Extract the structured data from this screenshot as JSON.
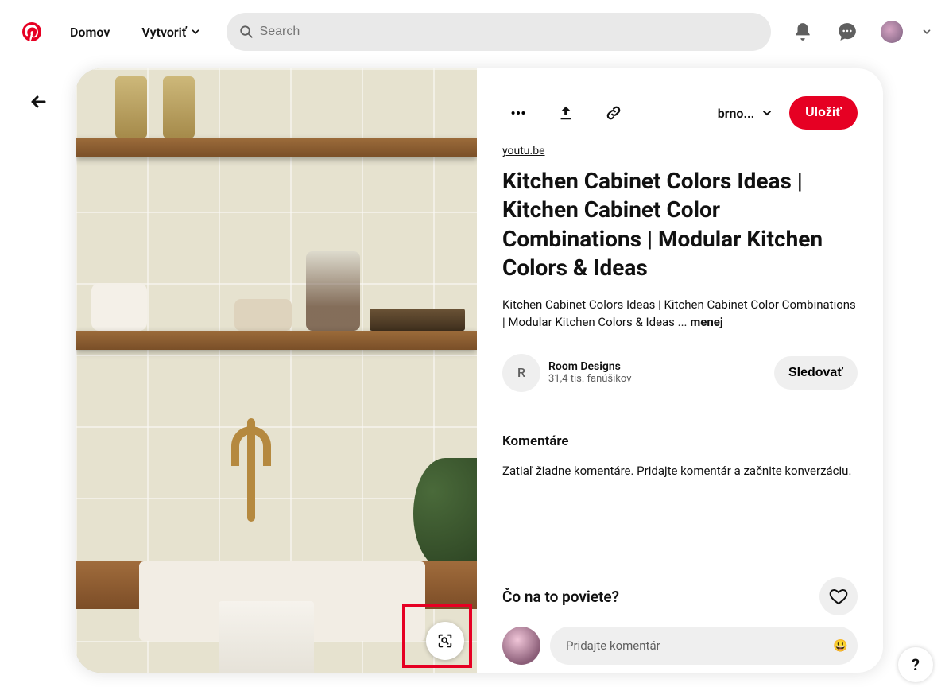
{
  "header": {
    "home": "Domov",
    "create": "Vytvoriť",
    "search_placeholder": "Search"
  },
  "pin": {
    "source": "youtu.be",
    "title": "Kitchen Cabinet Colors Ideas | Kitchen Cabinet Color Combinations | Modular Kitchen Colors & Ideas",
    "description": "Kitchen Cabinet Colors Ideas | Kitchen Cabinet Color Combinations | Modular Kitchen Colors & Ideas ... ",
    "less_label": "menej",
    "board_selected": "brno...",
    "save_label": "Uložiť"
  },
  "author": {
    "initial": "R",
    "name": "Room Designs",
    "followers": "31,4 tis. fanúšikov",
    "follow_label": "Sledovať"
  },
  "comments": {
    "title": "Komentáre",
    "empty": "Zatiaľ žiadne komentáre. Pridajte komentár a začnite konverzáciu."
  },
  "footer": {
    "cta": "Čo na to poviete?",
    "placeholder": "Pridajte komentár",
    "emoji": "😃"
  },
  "help": "?"
}
